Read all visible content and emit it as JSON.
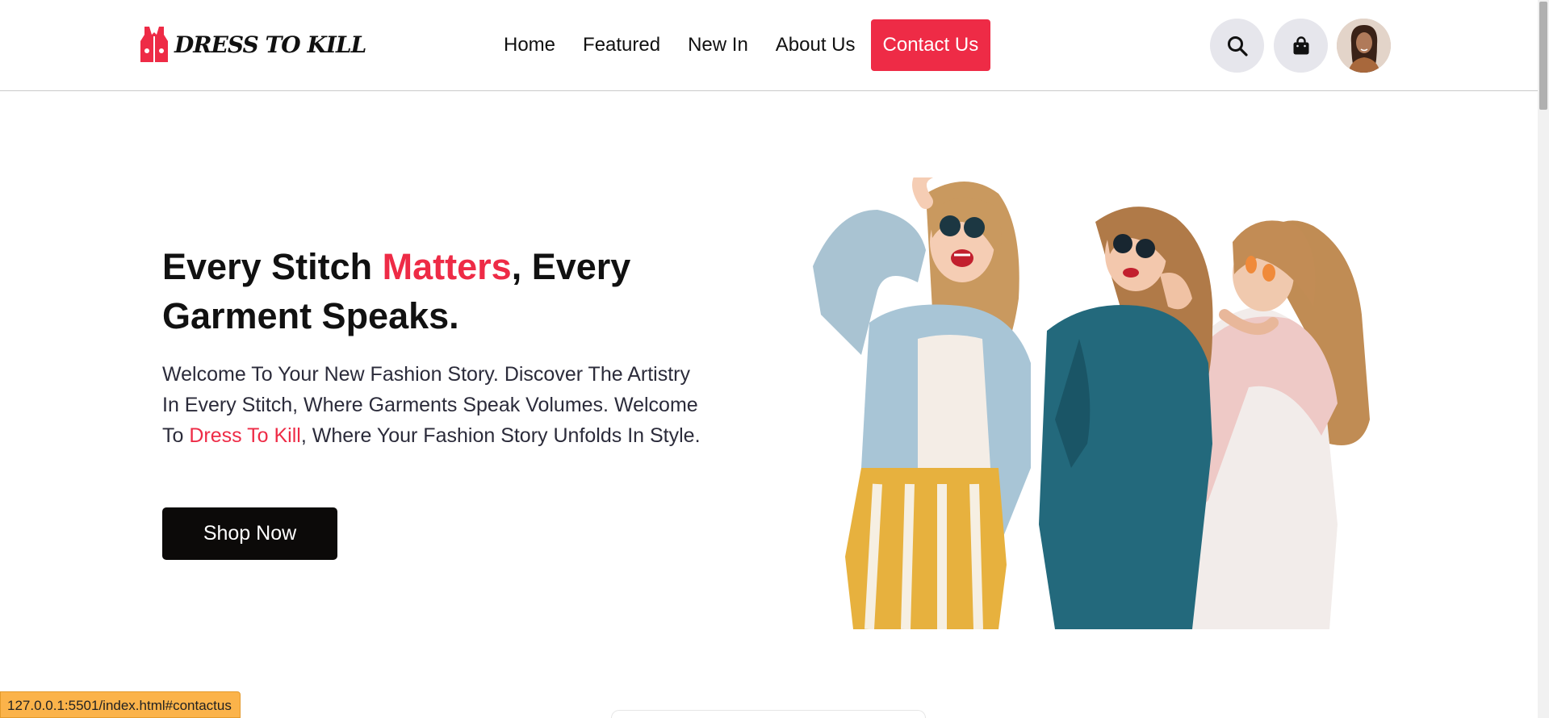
{
  "brand": {
    "name": "DRESS TO KILL",
    "accent_color": "#ee2b46"
  },
  "nav": {
    "items": [
      {
        "label": "Home"
      },
      {
        "label": "Featured"
      },
      {
        "label": "New In"
      },
      {
        "label": "About Us"
      }
    ],
    "contact_label": "Contact Us"
  },
  "header_icons": {
    "search": "search-icon",
    "cart": "shopping-bag-icon",
    "profile": "user-avatar"
  },
  "hero": {
    "title_part1": "Every Stitch ",
    "title_accent": "Matters",
    "title_part2": ", Every Garment Speaks.",
    "desc_part1": "Welcome To Your New Fashion Story. Discover The Artistry In Every Stitch, Where Garments Speak Volumes. Welcome To ",
    "desc_accent": "Dress To Kill",
    "desc_part2": ", Where Your Fashion Story Unfolds In Style.",
    "cta_label": "Shop Now",
    "image": "three-women-fashion-photo"
  },
  "status_bar": {
    "url": "127.0.0.1:5501/index.html#contactus"
  }
}
